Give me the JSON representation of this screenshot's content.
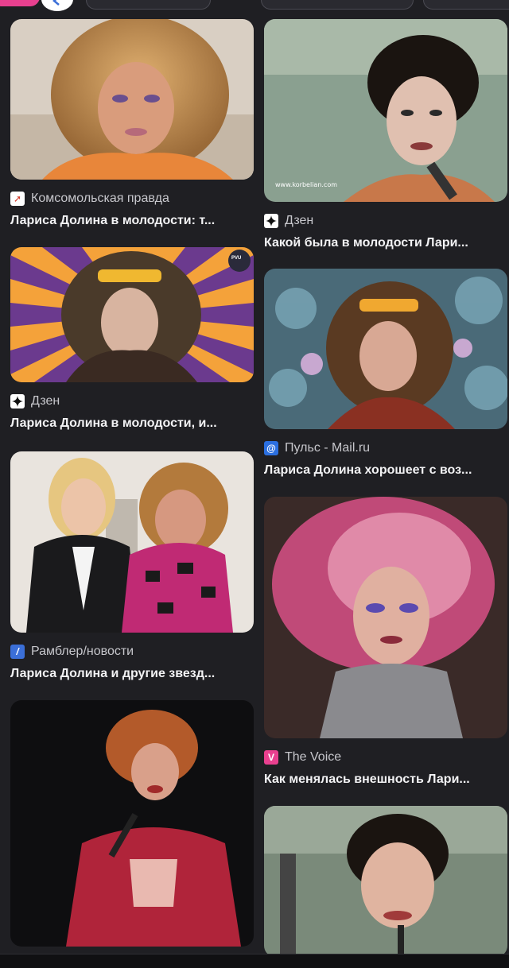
{
  "colors": {
    "background": "#1f1f23",
    "accent_pink": "#e9408f"
  },
  "results": [
    {
      "source": "Комсомольская правда",
      "title": "Лариса Долина в молодости: т...",
      "favicon": "kp-logo-icon"
    },
    {
      "source": "Дзен",
      "title": "Какой была в молодости Лари...",
      "favicon": "dzen-logo-icon"
    },
    {
      "source": "Дзен",
      "title": "Лариса Долина в молодости, и...",
      "favicon": "dzen-logo-icon"
    },
    {
      "source": "Пульс - Mail.ru",
      "title": "Лариса Долина хорошеет с воз...",
      "favicon": "mail-at-icon"
    },
    {
      "source": "Рамблер/новости",
      "title": "Лариса Долина и другие звезд...",
      "favicon": "rambler-logo-icon"
    },
    {
      "source": "The Voice",
      "title": "Как менялась внешность Лари...",
      "favicon": "voice-logo-icon"
    },
    {
      "source": "",
      "title": "",
      "favicon": ""
    },
    {
      "source": "",
      "title": "",
      "favicon": ""
    }
  ],
  "watermark": "www.korbelian.com",
  "badge_letters": "PVU"
}
